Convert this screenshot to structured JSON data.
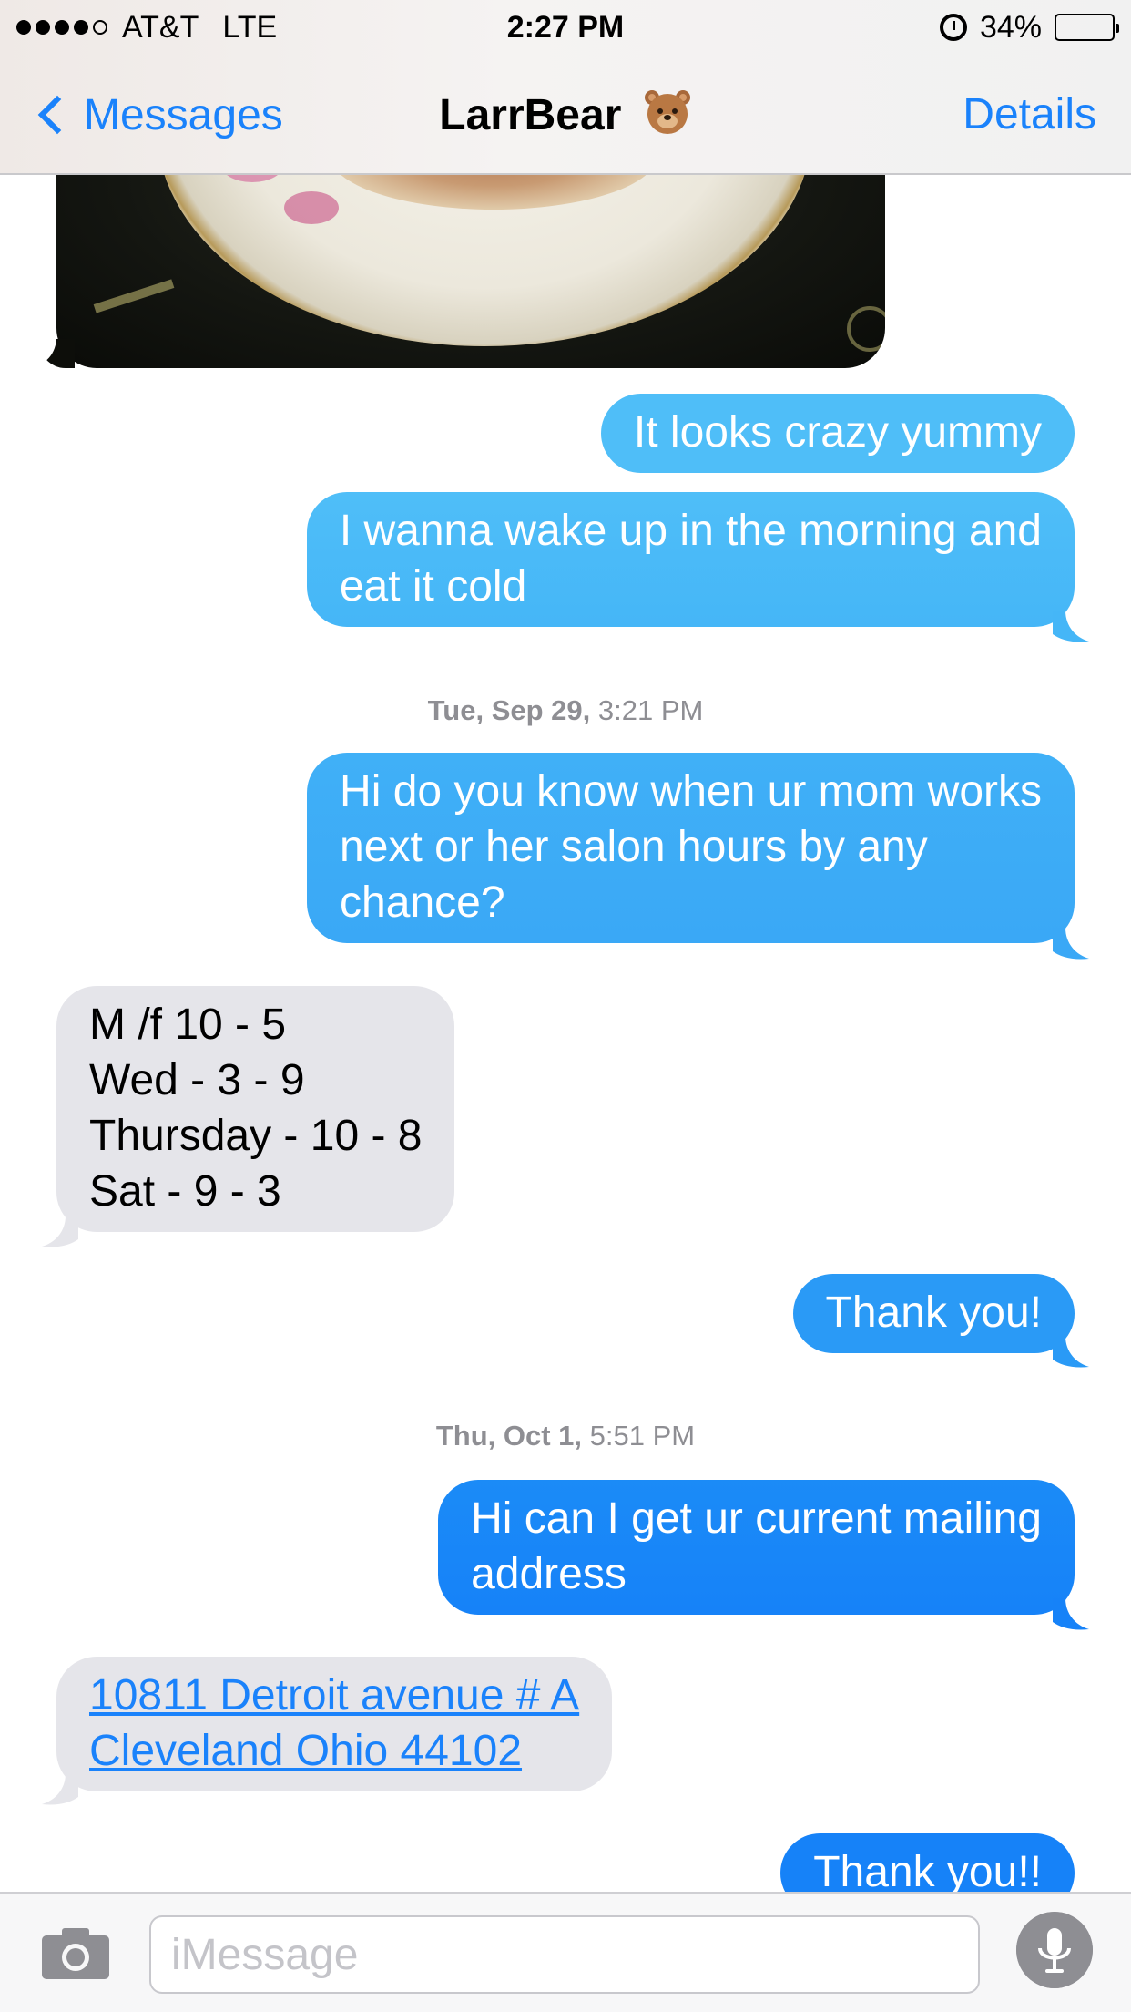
{
  "status_bar": {
    "carrier": "AT&T",
    "network": "LTE",
    "time": "2:27 PM",
    "battery": "34%",
    "battery_level": 0.34,
    "signal_bars": 4,
    "signal_max": 5,
    "icons": [
      "signal-dots-icon",
      "alarm-icon",
      "battery-icon"
    ]
  },
  "nav": {
    "back_label": "Messages",
    "title": "LarrBear",
    "title_emoji": "bear-face-icon",
    "details_label": "Details"
  },
  "colors": {
    "ios_blue": "#1a82fb",
    "bubble_out_top": "#4fbef8",
    "bubble_out_bottom": "#1682f8",
    "bubble_in": "#e5e5ea",
    "timestamp": "#8e8e93"
  },
  "conversation": {
    "photo": {
      "type": "image",
      "subject": "food on floral plate"
    },
    "messages": [
      {
        "dir": "out",
        "lines": [
          "It looks crazy yummy"
        ]
      },
      {
        "dir": "out",
        "lines": [
          "I wanna wake up in the morning and",
          "eat it cold"
        ]
      },
      {
        "type": "timestamp",
        "day": "Tue, Sep 29,",
        "time": "3:21 PM"
      },
      {
        "dir": "out",
        "lines": [
          "Hi do you know when ur mom works",
          "next or her salon hours by any",
          "chance?"
        ]
      },
      {
        "dir": "in",
        "lines": [
          "M /f 10 - 5",
          "Wed - 3 - 9",
          "Thursday - 10 - 8",
          "Sat - 9 - 3"
        ]
      },
      {
        "dir": "out",
        "lines": [
          "Thank you!"
        ]
      },
      {
        "type": "timestamp",
        "day": "Thu, Oct 1,",
        "time": "5:51 PM"
      },
      {
        "dir": "out",
        "lines": [
          "Hi can I get ur current mailing",
          "address"
        ]
      },
      {
        "dir": "in",
        "link": true,
        "lines": [
          "10811 Detroit avenue # A",
          "Cleveland Ohio 44102"
        ]
      },
      {
        "dir": "out",
        "lines": [
          "Thank you!!"
        ]
      }
    ]
  },
  "input_bar": {
    "placeholder": "iMessage",
    "camera_icon": "camera-icon",
    "mic_icon": "microphone-icon"
  }
}
